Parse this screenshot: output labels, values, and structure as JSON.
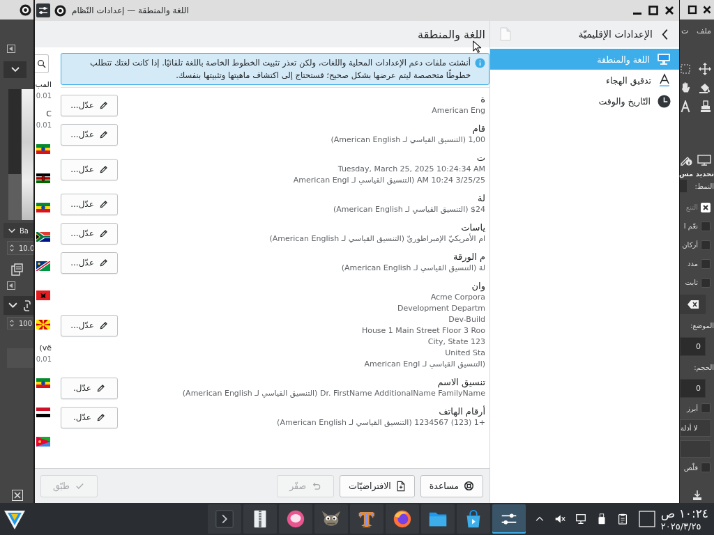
{
  "background_left": {
    "brush_name": "Ba",
    "brush_size": "10.0",
    "opacity": "100"
  },
  "settings_window": {
    "title": "اللغة والمنطقة — إعدادات النّظام",
    "sidebar": {
      "header": "الإعدادات الإقليميّة",
      "items": [
        {
          "label": "اللغة والمنطقة",
          "selected": true
        },
        {
          "label": "تدقيق الهجاء",
          "selected": false
        },
        {
          "label": "التّاريخ والوقت",
          "selected": false
        }
      ]
    },
    "page_title": "اللغة والمنطقة",
    "info_message": "أنشئت ملفات دعم الإعدادات المحلية واللغات، ولكن تعذر تثبيت الخطوط الخاصة باللغة تلقائيًا. إذا كانت لغتك تتطلب خطوطًا متخصصة ليتم عرضها بشكل صحيح؛ فستحتاج إلى اكتشاف ماهيتها وتثبيتها بنفسك.",
    "settings": [
      {
        "label": "ة",
        "values": [
          "American Eng"
        ],
        "button": "عدّل..."
      },
      {
        "label": "قام",
        "values": [
          "1,00 (التنسيق القياسي لـ American English)"
        ],
        "button": "عدّل..."
      },
      {
        "label": "ت",
        "values": [
          "Tuesday, March 25, 2025 10:24:34 AM",
          "3/25/25 10:24 AM (التنسيق القياسي لـ American Engl"
        ],
        "button": "عدّل..."
      },
      {
        "label": "لة",
        "values": [
          "$24 (التنسيق القياسي لـ American English)"
        ],
        "button": "عدّل..."
      },
      {
        "label": "ياسات",
        "values": [
          "ام الأمريكيّ الإمبراطوريّ (التنسيق القياسي لـ American English)"
        ],
        "button": "عدّل..."
      },
      {
        "label": "م الورقة",
        "values": [
          "لة (التنسيق القياسي لـ American English)"
        ],
        "button": "عدّل..."
      },
      {
        "label": "وان",
        "values": [
          "Acme Corpora",
          "Development Departm",
          "Dev-Build",
          "House 1 Main Street Floor 3 Roo",
          "City, State 123",
          "United Sta",
          "(التنسيق القياسي لـ American Engl"
        ],
        "button": "عدّل..."
      },
      {
        "label": "تنسيق الاسم",
        "values": [
          "Dr. FirstName AdditionalName FamilyName (التنسيق القياسي لـ American English)"
        ],
        "button": "عدّل."
      },
      {
        "label": "أرقام الهاتف",
        "values": [
          "+1 (123) 1234567 (التنسيق القياسي لـ American English)"
        ],
        "button": "عدّل."
      }
    ],
    "language_list": [
      {
        "kind": "entry",
        "lines": [
          "المب",
          "0.01"
        ]
      },
      {
        "kind": "entry",
        "lines": [
          "C",
          "0.01"
        ]
      },
      {
        "kind": "flag"
      },
      {
        "kind": "flag"
      },
      {
        "kind": "flag"
      },
      {
        "kind": "flag"
      },
      {
        "kind": "flag"
      },
      {
        "kind": "flag"
      },
      {
        "kind": "flag"
      },
      {
        "kind": "entry",
        "lines": [
          "vë)",
          "0,01"
        ]
      },
      {
        "kind": "flag"
      },
      {
        "kind": "flag"
      },
      {
        "kind": "flag"
      }
    ],
    "footer_buttons": [
      {
        "label": "مساعدة",
        "disabled": false
      },
      {
        "label": "الافتراضيّات",
        "disabled": false
      },
      {
        "label": "صفّر",
        "disabled": true
      },
      {
        "label": "طبّق",
        "disabled": true
      }
    ]
  },
  "background_right": {
    "menu": [
      "ملف",
      "ت"
    ],
    "panel_title": "تحديد مس",
    "mode_label": "النمط:",
    "options": [
      {
        "label": "التنع",
        "checked": true,
        "disabled": true
      },
      {
        "label": "نعّم ا",
        "checked": false,
        "disabled": false
      },
      {
        "label": "أركان",
        "checked": false,
        "disabled": false
      },
      {
        "label": "مدد",
        "checked": false,
        "disabled": false
      },
      {
        "label": "ثابت",
        "checked": false,
        "disabled": false
      }
    ],
    "position_label": "الموضع:",
    "position_value": "0",
    "size_label": "الحجم:",
    "size_value": "0",
    "highlight": {
      "label": "أبرز",
      "checked": false
    },
    "guides": "لا أدلة",
    "shrink": {
      "label": "قلّص",
      "checked": false
    }
  },
  "taskbar": {
    "tasks": [
      {
        "selected": false
      },
      {
        "selected": false
      },
      {
        "selected": false
      },
      {
        "selected": false
      },
      {
        "label": "T",
        "selected": false
      },
      {
        "selected": false
      },
      {
        "selected": false
      },
      {
        "selected": false
      },
      {
        "selected": true
      }
    ],
    "clock_time": "١٠:٢٤ ص",
    "clock_date": "٢٠٢٥/٣/٢٥"
  }
}
